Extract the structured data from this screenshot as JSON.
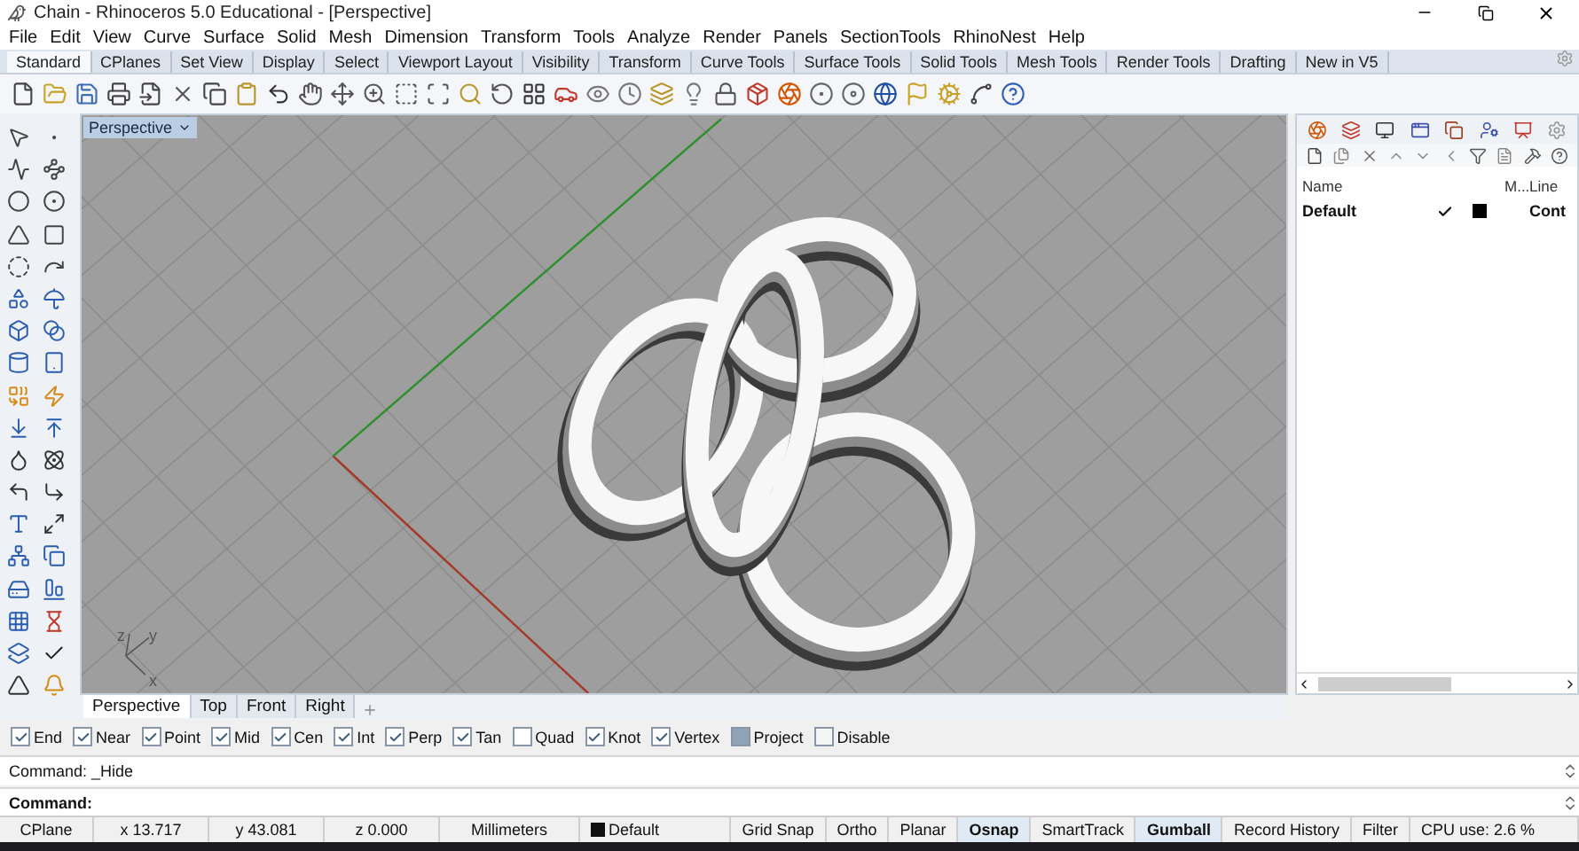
{
  "window": {
    "title": "Chain - Rhinoceros 5.0 Educational - [Perspective]"
  },
  "menu": [
    "File",
    "Edit",
    "View",
    "Curve",
    "Surface",
    "Solid",
    "Mesh",
    "Dimension",
    "Transform",
    "Tools",
    "Analyze",
    "Render",
    "Panels",
    "SectionTools",
    "RhinoNest",
    "Help"
  ],
  "toolbar_tabs": [
    {
      "label": "Standard",
      "selected": true
    },
    {
      "label": "CPlanes",
      "selected": false
    },
    {
      "label": "Set View",
      "selected": false
    },
    {
      "label": "Display",
      "selected": false
    },
    {
      "label": "Select",
      "selected": false
    },
    {
      "label": "Viewport Layout",
      "selected": false
    },
    {
      "label": "Visibility",
      "selected": false
    },
    {
      "label": "Transform",
      "selected": false
    },
    {
      "label": "Curve Tools",
      "selected": false
    },
    {
      "label": "Surface Tools",
      "selected": false
    },
    {
      "label": "Solid Tools",
      "selected": false
    },
    {
      "label": "Mesh Tools",
      "selected": false
    },
    {
      "label": "Render Tools",
      "selected": false
    },
    {
      "label": "Drafting",
      "selected": false
    },
    {
      "label": "New in V5",
      "selected": false
    }
  ],
  "viewport": {
    "label": "Perspective",
    "axis_labels": [
      "z",
      "y",
      "x"
    ]
  },
  "viewport_tabs": [
    {
      "label": "Perspective",
      "selected": true
    },
    {
      "label": "Top",
      "selected": false
    },
    {
      "label": "Front",
      "selected": false
    },
    {
      "label": "Right",
      "selected": false
    }
  ],
  "layers_panel": {
    "columns": [
      "Name",
      "M...",
      "Line"
    ],
    "rows": [
      {
        "name": "Default",
        "current": true,
        "color": "#000000",
        "linetype": "Cont"
      }
    ]
  },
  "osnaps": [
    {
      "label": "End",
      "kind": "checkbox",
      "checked": true
    },
    {
      "label": "Near",
      "kind": "checkbox",
      "checked": true
    },
    {
      "label": "Point",
      "kind": "checkbox",
      "checked": true
    },
    {
      "label": "Mid",
      "kind": "checkbox",
      "checked": true
    },
    {
      "label": "Cen",
      "kind": "checkbox",
      "checked": true
    },
    {
      "label": "Int",
      "kind": "checkbox",
      "checked": true
    },
    {
      "label": "Perp",
      "kind": "checkbox",
      "checked": true
    },
    {
      "label": "Tan",
      "kind": "checkbox",
      "checked": true
    },
    {
      "label": "Quad",
      "kind": "checkbox",
      "checked": false
    },
    {
      "label": "Knot",
      "kind": "checkbox",
      "checked": true
    },
    {
      "label": "Vertex",
      "kind": "checkbox",
      "checked": true
    },
    {
      "label": "Project",
      "kind": "toggle",
      "checked": true
    },
    {
      "label": "Disable",
      "kind": "toggle",
      "checked": false
    }
  ],
  "command": {
    "history": "Command: _Hide",
    "prompt": "Command:"
  },
  "status_bar": {
    "cplane": "CPlane",
    "coords": [
      "x 13.717",
      "y 43.081",
      "z 0.000"
    ],
    "units": "Millimeters",
    "layer": "Default",
    "toggles": [
      {
        "label": "Grid Snap",
        "on": false
      },
      {
        "label": "Ortho",
        "on": false
      },
      {
        "label": "Planar",
        "on": false
      },
      {
        "label": "Osnap",
        "on": true
      },
      {
        "label": "SmartTrack",
        "on": false
      },
      {
        "label": "Gumball",
        "on": true
      },
      {
        "label": "Record History",
        "on": false
      },
      {
        "label": "Filter",
        "on": false
      }
    ],
    "cpu": "CPU use: 2.6 %"
  }
}
